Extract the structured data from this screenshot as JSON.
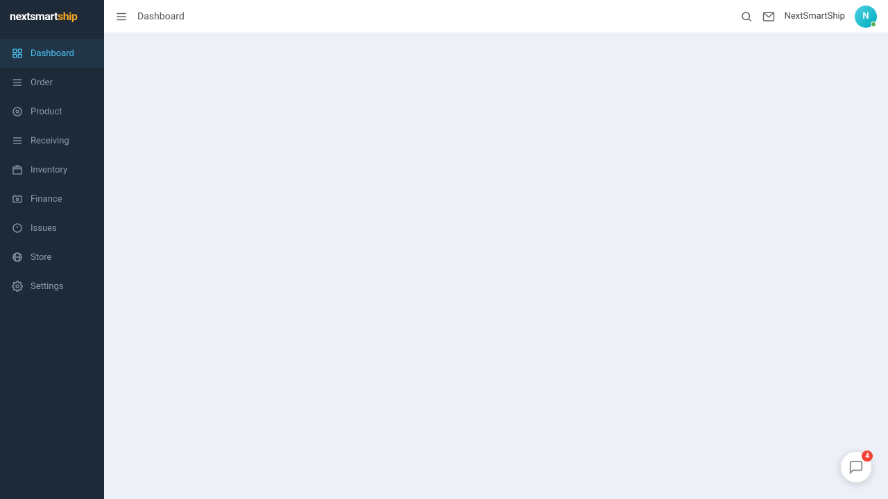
{
  "app": {
    "name": "nextsmartship",
    "logo": {
      "next": "next",
      "smart": "smart",
      "ship": "ship"
    }
  },
  "header": {
    "title": "Dashboard",
    "username": "NextSmartShip",
    "avatar_initials": "N",
    "chat_badge": "4"
  },
  "sidebar": {
    "items": [
      {
        "id": "dashboard",
        "label": "Dashboard",
        "active": true
      },
      {
        "id": "order",
        "label": "Order",
        "active": false
      },
      {
        "id": "product",
        "label": "Product",
        "active": false
      },
      {
        "id": "receiving",
        "label": "Receiving",
        "active": false
      },
      {
        "id": "inventory",
        "label": "Inventory",
        "active": false
      },
      {
        "id": "finance",
        "label": "Finance",
        "active": false
      },
      {
        "id": "issues",
        "label": "Issues",
        "active": false
      },
      {
        "id": "store",
        "label": "Store",
        "active": false
      },
      {
        "id": "settings",
        "label": "Settings",
        "active": false
      }
    ]
  }
}
